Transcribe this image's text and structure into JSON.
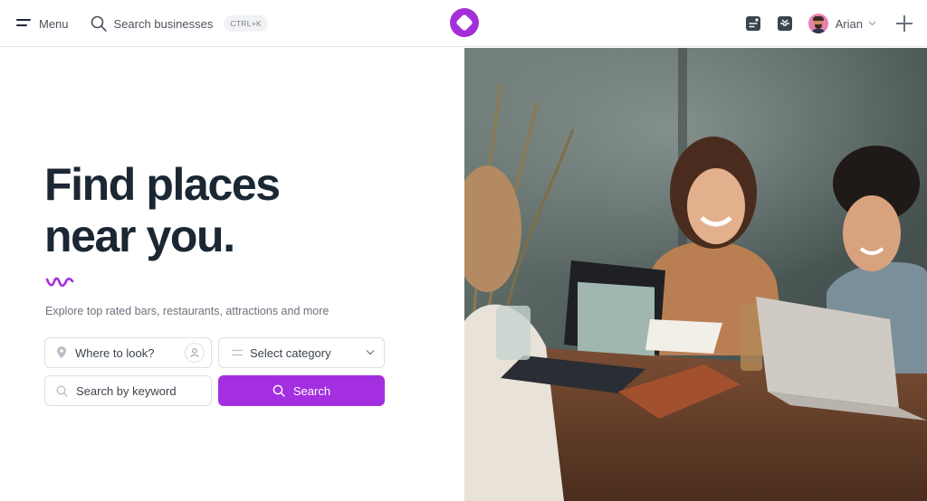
{
  "header": {
    "menu_label": "Menu",
    "search_label": "Search businesses",
    "shortcut": "CTRL+K",
    "user_name": "Arian"
  },
  "hero": {
    "title_line1": "Find places",
    "title_line2": "near you.",
    "subtitle": "Explore top rated bars, restaurants, attractions and more"
  },
  "search_form": {
    "where_placeholder": "Where to look?",
    "category_placeholder": "Select category",
    "keyword_placeholder": "Search by keyword",
    "search_button": "Search"
  },
  "colors": {
    "accent": "#a42fe0",
    "text": "#1b2733"
  },
  "icons": [
    "menu-icon",
    "search-icon",
    "logo-icon",
    "notes-icon",
    "inbox-icon",
    "avatar",
    "chevron-down-icon",
    "plus-icon",
    "location-pin-icon",
    "user-locate-icon",
    "list-icon",
    "squiggle-icon"
  ]
}
